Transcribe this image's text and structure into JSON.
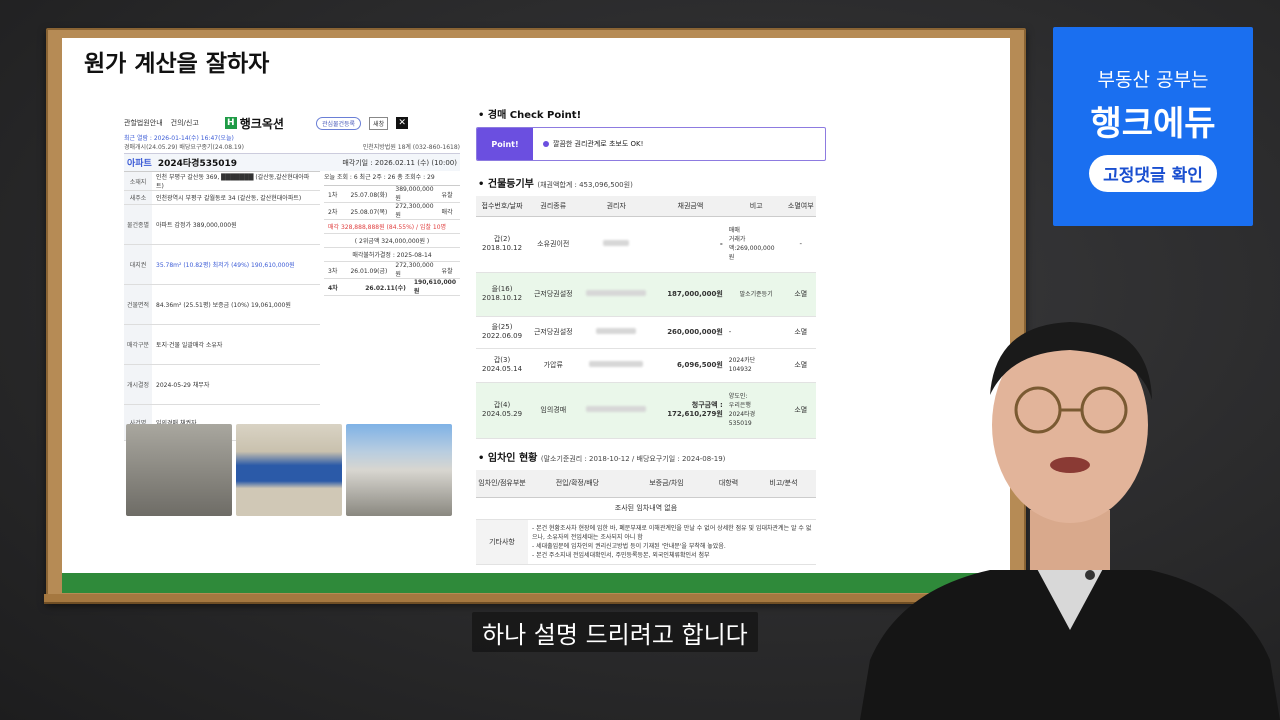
{
  "board": {
    "title": "원가 계산을 잘하자"
  },
  "auction_site": {
    "nav1": "관할법원안내",
    "nav2": "건의/신고",
    "logo": "행크옥션",
    "chip": "관심물건등록",
    "window_btn": "새창",
    "close": "✕",
    "meta_left1": "최근 열람 : 2026-01-14(수) 16:47(오늘)",
    "meta_left2": "경매개시(24.05.29) 배당요구종기(24.08.19)",
    "meta_right": "인천지방법원 18계 (032-860-1618)",
    "type": "아파트",
    "case_no": "2024타경535019",
    "sale_date": "매각기일 : 2026.02.11 (수) (10:00)",
    "rows": [
      {
        "k": "소재지",
        "v": "인천 부평구 갈산동 369, ███████ (갈산동,갈산현대아파트)"
      },
      {
        "k": "새주소",
        "v": "인천광역시 부평구 갈월동로 34 (갈산동, 갈산현대아파트)"
      },
      {
        "k": "물건종별",
        "v": "아파트   감정가   389,000,000원"
      },
      {
        "k": "대지권",
        "v": "35.78m² (10.82평)   최저가  (49%) 190,610,000원"
      },
      {
        "k": "건물면적",
        "v": "84.36m² (25.51평)   보증금   (10%) 19,061,000원"
      },
      {
        "k": "매각구분",
        "v": "토지·건물 일괄매각   소유자"
      },
      {
        "k": "개시결정",
        "v": "2024-05-29   채무자"
      },
      {
        "k": "사건명",
        "v": "임의경매   채권자"
      }
    ],
    "hist_head": "오늘 조회 : 6   최근 2주 : 26   총 조회수 : 29",
    "hist": [
      {
        "r": "1차",
        "d": "25.07.08(화)",
        "p": "389,000,000원",
        "s": "유찰"
      },
      {
        "r": "2차",
        "d": "25.08.07(목)",
        "p": "272,300,000원",
        "s": "매각"
      },
      {
        "r": "3차",
        "d": "26.01.09(금)",
        "p": "272,300,000원",
        "s": "유찰"
      },
      {
        "r": "4차",
        "d": "26.02.11(수)",
        "p": "190,610,000원",
        "s": ""
      }
    ],
    "hist_note1": "매각 328,888,888원 (84.55%) / 입찰 10명",
    "hist_note2": "( 2위금액 324,000,000원 )",
    "hist_note3": "매각불허가결정 : 2025-08-14"
  },
  "check_point": {
    "heading": "• 경매 Check Point!",
    "label": "Point!",
    "text": "깔끔한 권리관계로 초보도 OK!"
  },
  "registry": {
    "heading": "• 건물등기부",
    "sub": "(채권액합계 : 453,096,500원)",
    "cols": [
      "접수번호/날짜",
      "권리종류",
      "권리자",
      "채권금액",
      "비고",
      "소멸여부"
    ],
    "rows": [
      {
        "no": "갑(2)",
        "date": "2018.10.12",
        "type": "소유권이전",
        "amount": "-",
        "note": "매매\n거래가\n액:269,000,000\n원",
        "status": "-",
        "green": false
      },
      {
        "no": "을(16)",
        "date": "2018.10.12",
        "type": "근저당권설정",
        "amount": "187,000,000원",
        "note": "말소기준등기",
        "status": "소멸",
        "green": true
      },
      {
        "no": "을(25)",
        "date": "2022.06.09",
        "type": "근저당권설정",
        "amount": "260,000,000원",
        "note": "-",
        "status": "소멸",
        "green": false
      },
      {
        "no": "갑(3)",
        "date": "2024.05.14",
        "type": "가압류",
        "amount": "6,096,500원",
        "note": "2024카단\n104932",
        "status": "소멸",
        "green": false
      },
      {
        "no": "갑(4)",
        "date": "2024.05.29",
        "type": "임의경매",
        "amount": "청구금액 :\n172,610,279원",
        "note": "양도인:\n우리은행\n2024타경\n535019",
        "status": "소멸",
        "green": true
      }
    ]
  },
  "tenant": {
    "heading": "• 임차인 현황",
    "sub": "(말소기준권리 : 2018-10-12 / 배당요구기일 : 2024-08-19)",
    "cols": [
      "임차인/점유부분",
      "전입/확정/배당",
      "보증금/차임",
      "대항력",
      "비고/분석"
    ],
    "empty": "조사된 임차내역 없음",
    "etc_label": "기타사항",
    "etc": [
      "- 본건 현황조사차 현장에 임한 바, 폐문부재로 이해관계인을 만날 수 없어 상세한 점유 및 임대차관계는 알 수 없으나, 소유자의 전입세대는 조사되지 아니 함",
      "- 세대출입문에 임차인의 권리신고방법 등이 기재된 '안내문'을 부착해 놓았음.",
      "- 본건 주소지내 전입세대확인서, 주민등록등본, 외국인체류확인서 첨부"
    ]
  },
  "promo": {
    "line1": "부동산 공부는",
    "line2": "행크에듀",
    "button": "고정댓글 확인"
  },
  "subtitle": "하나 설명 드리려고 합니다",
  "colors": {
    "accent": "#1a6ff0",
    "point": "#6b4fe0",
    "board_green": "#2f8a3a"
  }
}
